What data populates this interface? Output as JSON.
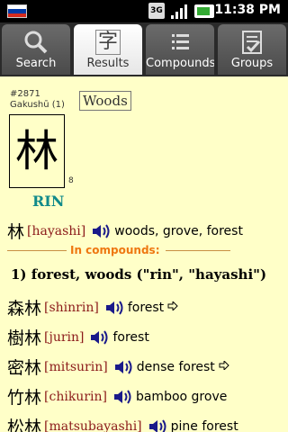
{
  "status_bar": {
    "network": "3G",
    "time": "11:38 PM",
    "flag_colors": [
      "#ffffff",
      "#0039a6",
      "#d52b1e"
    ]
  },
  "tabs": [
    {
      "label": "Search",
      "icon": "search-icon",
      "selected": false
    },
    {
      "label": "Results",
      "icon": "kanji-icon",
      "glyph": "字",
      "selected": true
    },
    {
      "label": "Compounds",
      "icon": "list-icon",
      "selected": false
    },
    {
      "label": "Groups",
      "icon": "checklist-icon",
      "selected": false
    }
  ],
  "entry": {
    "number": "#2871",
    "grade": "Gakushū (1)",
    "meaning": "Woods",
    "kanji": "林",
    "stroke_count": "8",
    "reading": "RIN",
    "main_line": {
      "kanji": "林",
      "romaji": "[hayashi]",
      "gloss": "woods, grove, forest"
    }
  },
  "compounds_header": "In compounds:",
  "group_title": "1) forest, woods (\"rin\", \"hayashi\")",
  "compounds": [
    {
      "kanji": "森林",
      "romaji": "[shinrin]",
      "gloss": "forest",
      "arrow": true
    },
    {
      "kanji": "樹林",
      "romaji": "[jurin]",
      "gloss": "forest",
      "arrow": false
    },
    {
      "kanji": "密林",
      "romaji": "[mitsurin]",
      "gloss": "dense forest",
      "arrow": true
    },
    {
      "kanji": "竹林",
      "romaji": "[chikurin]",
      "gloss": "bamboo grove",
      "arrow": false
    },
    {
      "kanji": "松林",
      "romaji": "[matsubayashi]",
      "gloss": "pine forest",
      "arrow": false
    }
  ],
  "colors": {
    "background": "#ffffc8",
    "reading": "#118a8a",
    "romaji": "#8b1a1a",
    "compounds_header": "#ee7711"
  }
}
